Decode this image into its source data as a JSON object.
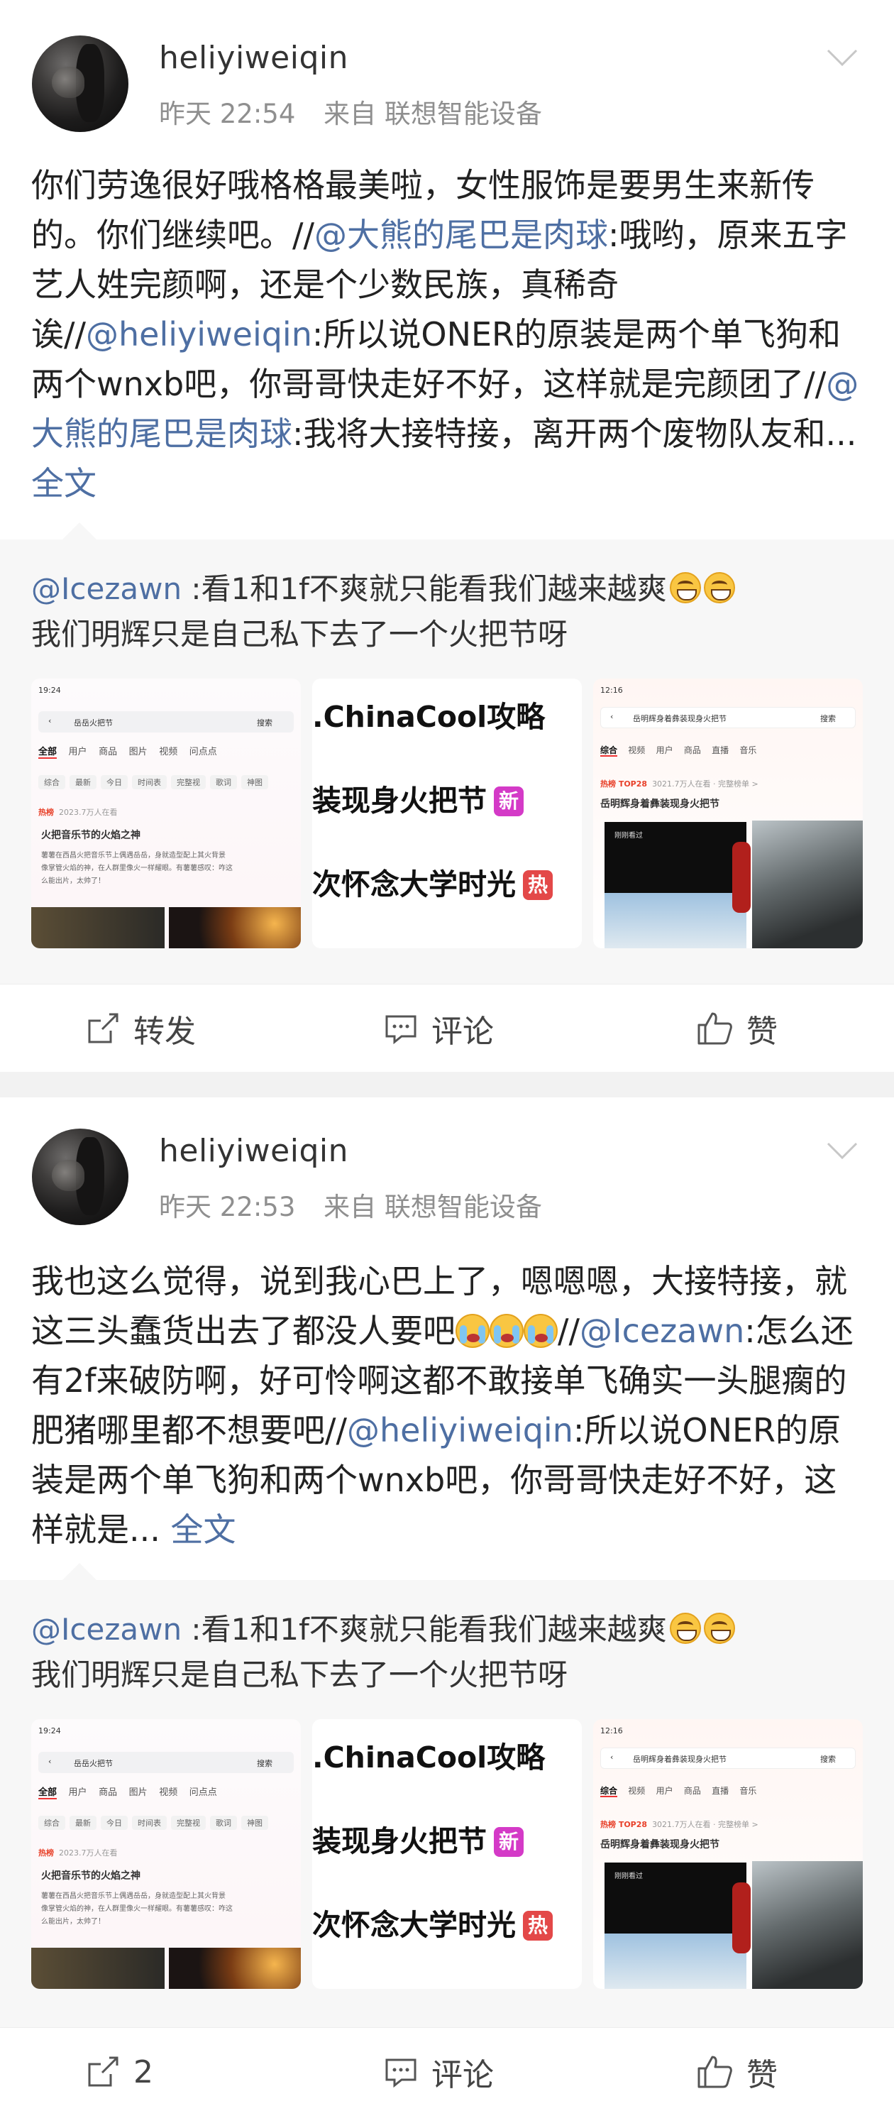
{
  "posts": [
    {
      "username": "heliyiweiqin",
      "time": "昨天 22:54",
      "source": "来自 联想智能设备",
      "body": [
        {
          "t": "你们劳逸很好哦格格最美啦，女性服饰是要男生来新传的。你们继续吧。//"
        },
        {
          "t": "@大熊的尾巴是肉球",
          "link": true
        },
        {
          "t": ":哦哟，原来五字艺人姓完颜啊，还是个少数民族，真稀奇诶//"
        },
        {
          "t": "@heliyiweiqin",
          "link": true
        },
        {
          "t": ":所以说ONER的原装是两个单飞狗和两个wnxb吧，你哥哥快走好不好，这样就是完颜团了//"
        },
        {
          "t": "@大熊的尾巴是肉球",
          "link": true
        },
        {
          "t": ":我将大接特接，离开两个废物队友和... "
        },
        {
          "t": "全文",
          "link": true
        }
      ],
      "repost": {
        "mention": "@Icezawn",
        "text_line1": " :看1和1f不爽就只能看我们越来越爽",
        "text_line2": "我们明辉只是自己私下去了一个火把节呀"
      },
      "actions": {
        "repost": "转发",
        "comment": "评论",
        "like": "赞"
      }
    },
    {
      "username": "heliyiweiqin",
      "time": "昨天 22:53",
      "source": "来自 联想智能设备",
      "body": [
        {
          "t": "我也这么觉得，说到我心巴上了，嗯嗯嗯，大接特接，就这三头蠢货出去了都没人要吧"
        },
        {
          "t": "[cry][cry][cry]",
          "emoji": true
        },
        {
          "t": "//"
        },
        {
          "t": "@Icezawn",
          "link": true
        },
        {
          "t": ":怎么还有2f来破防啊，好可怜啊这都不敢接单飞确实一头腿瘸的肥猪哪里都不想要吧//"
        },
        {
          "t": "@heliyiweiqin",
          "link": true
        },
        {
          "t": ":所以说ONER的原装是两个单飞狗和两个wnxb吧，你哥哥快走好不好，这样就是... "
        },
        {
          "t": "全文",
          "link": true
        }
      ],
      "repost": {
        "mention": "@Icezawn",
        "text_line1": " :看1和1f不爽就只能看我们越来越爽",
        "text_line2": "我们明辉只是自己私下去了一个火把节呀"
      },
      "actions": {
        "repost": "2",
        "comment": "评论",
        "like": "赞"
      }
    }
  ],
  "thumb1": {
    "status_time": "19:24",
    "search": "岳岳火把节",
    "search_btn": "搜索",
    "tabs": [
      "全部",
      "用户",
      "商品",
      "图片",
      "视频"
    ],
    "tab_extra": "问点点",
    "chips": [
      "综合",
      "最新",
      "今日",
      "时间表",
      "完整视",
      "歌词",
      "神图"
    ],
    "hot_label": "热榜",
    "hot_meta": "2023.7万人在看",
    "title": "火把音乐节的火焰之神",
    "desc1": "薯薯在西昌火把音乐节上偶遇岳岳，身就造型配上其火背景",
    "desc2": "像掌管火焰的神，在人群里像火一样耀眼。有薯薯感叹：咋这",
    "desc3": "么能出片，太帅了！"
  },
  "thumb2": {
    "line1": ".ChinaCool攻略",
    "line2": "装现身火把节",
    "line2_badge": "新",
    "line3": "次怀念大学时光",
    "line3_badge": "热"
  },
  "thumb3": {
    "status_time": "12:16",
    "search": "岳明辉身着彝装现身火把节",
    "search_btn": "搜索",
    "tabs": [
      "综合",
      "视频",
      "用户",
      "商品",
      "直播",
      "音乐"
    ],
    "hot_label": "热榜 TOP28",
    "hot_meta": "3021.7万人在看 · 完整榜单 >",
    "title": "岳明辉身着彝装现身火把节",
    "overlay": "刚刚看过"
  },
  "colors": {
    "link": "#4e6fa3",
    "meta": "#8f8f8f",
    "repost_bg": "#f7f7f7",
    "divider": "#f2f2f2"
  }
}
